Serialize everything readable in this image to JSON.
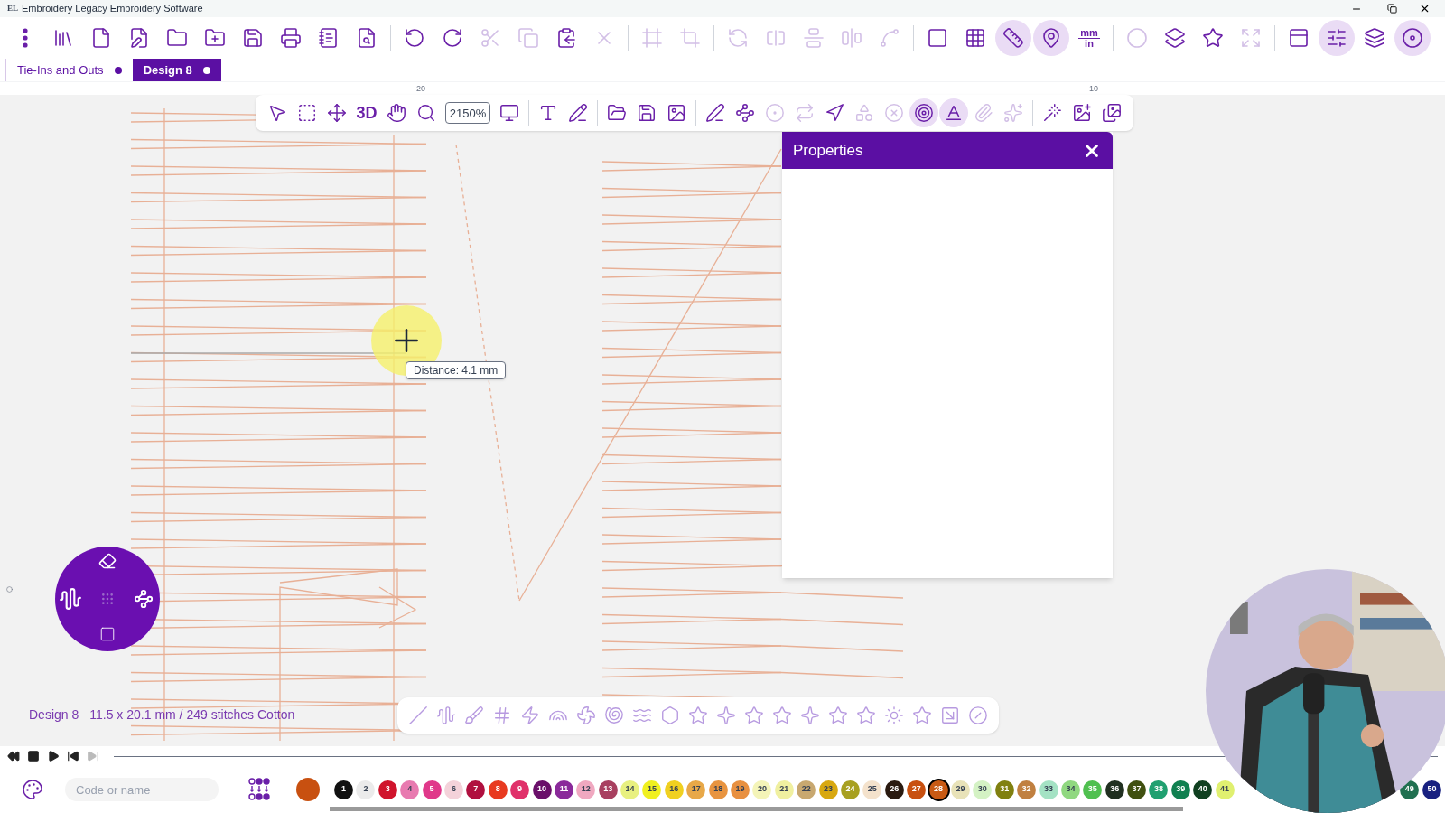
{
  "window": {
    "logo": "EL",
    "title": "Embroidery Legacy Embroidery Software"
  },
  "main_toolbar": [
    {
      "buttons": [
        {
          "kind": "icon",
          "disabled": false,
          "highlighted": false
        },
        {
          "kind": "icon",
          "disabled": false,
          "highlighted": false
        },
        {
          "kind": "icon",
          "disabled": false,
          "highlighted": false
        },
        {
          "kind": "icon",
          "disabled": false,
          "highlighted": false
        },
        {
          "kind": "icon",
          "disabled": false,
          "highlighted": false
        },
        {
          "kind": "icon",
          "disabled": false,
          "highlighted": false
        },
        {
          "kind": "icon",
          "disabled": false,
          "highlighted": false
        },
        {
          "kind": "icon",
          "disabled": false,
          "highlighted": false
        },
        {
          "kind": "icon",
          "disabled": false,
          "highlighted": false
        },
        {
          "kind": "icon",
          "disabled": false,
          "highlighted": false
        }
      ]
    },
    {
      "buttons": [
        {
          "kind": "icon",
          "disabled": false,
          "highlighted": false
        },
        {
          "kind": "icon",
          "disabled": false,
          "highlighted": false
        },
        {
          "kind": "icon",
          "disabled": true,
          "highlighted": false
        },
        {
          "kind": "icon",
          "disabled": true,
          "highlighted": false
        },
        {
          "kind": "icon",
          "disabled": false,
          "highlighted": false
        },
        {
          "kind": "icon",
          "disabled": true,
          "highlighted": false
        }
      ]
    },
    {
      "buttons": [
        {
          "kind": "icon",
          "disabled": true,
          "highlighted": false
        },
        {
          "kind": "icon",
          "disabled": true,
          "highlighted": false
        }
      ]
    },
    {
      "buttons": [
        {
          "kind": "icon",
          "disabled": true,
          "highlighted": false
        },
        {
          "kind": "icon",
          "disabled": true,
          "highlighted": false
        },
        {
          "kind": "icon",
          "disabled": true,
          "highlighted": false
        },
        {
          "kind": "icon",
          "disabled": true,
          "highlighted": false
        },
        {
          "kind": "icon",
          "disabled": true,
          "highlighted": false
        }
      ]
    },
    {
      "buttons": [
        {
          "kind": "icon",
          "disabled": false,
          "highlighted": false
        },
        {
          "kind": "icon",
          "disabled": false,
          "highlighted": false
        },
        {
          "kind": "icon",
          "disabled": false,
          "highlighted": true
        },
        {
          "kind": "icon",
          "disabled": false,
          "highlighted": true
        },
        {
          "kind": "units",
          "top": "mm",
          "bottom": "in",
          "disabled": false,
          "highlighted": false
        }
      ]
    },
    {
      "buttons": [
        {
          "kind": "icon",
          "disabled": true,
          "highlighted": false
        },
        {
          "kind": "icon",
          "disabled": false,
          "highlighted": false
        },
        {
          "kind": "icon",
          "disabled": false,
          "highlighted": false
        },
        {
          "kind": "icon",
          "disabled": true,
          "highlighted": false
        }
      ]
    },
    {
      "buttons": [
        {
          "kind": "icon",
          "disabled": false,
          "highlighted": false
        },
        {
          "kind": "icon",
          "disabled": false,
          "highlighted": true
        },
        {
          "kind": "icon",
          "disabled": false,
          "highlighted": false
        },
        {
          "kind": "icon",
          "disabled": false,
          "highlighted": true
        }
      ]
    }
  ],
  "tabs": [
    {
      "label": "Tie-Ins and Outs",
      "selected": false,
      "modified": true
    },
    {
      "label": "Design 8",
      "selected": true,
      "modified": true
    }
  ],
  "ruler_labels": [
    "-20",
    "-10"
  ],
  "canvas_toolbar": [
    {
      "buttons": [
        {
          "kind": "icon",
          "disabled": false,
          "highlighted": false
        },
        {
          "kind": "icon",
          "disabled": false,
          "highlighted": false
        },
        {
          "kind": "icon",
          "disabled": false,
          "highlighted": false
        },
        {
          "kind": "text",
          "label": "3D",
          "disabled": false,
          "highlighted": false
        },
        {
          "kind": "icon",
          "disabled": false,
          "highlighted": false
        },
        {
          "kind": "icon",
          "disabled": false,
          "highlighted": false
        },
        {
          "kind": "zoom",
          "value": "2150%",
          "disabled": false,
          "highlighted": false
        },
        {
          "kind": "icon",
          "disabled": false,
          "highlighted": false
        }
      ]
    },
    {
      "buttons": [
        {
          "kind": "icon",
          "disabled": false,
          "highlighted": false
        },
        {
          "kind": "icon",
          "disabled": false,
          "highlighted": false
        }
      ]
    },
    {
      "buttons": [
        {
          "kind": "icon",
          "disabled": false,
          "highlighted": false
        },
        {
          "kind": "icon",
          "disabled": false,
          "highlighted": false
        },
        {
          "kind": "icon",
          "disabled": false,
          "highlighted": false
        }
      ]
    },
    {
      "buttons": [
        {
          "kind": "icon",
          "disabled": false,
          "highlighted": false
        },
        {
          "kind": "icon",
          "disabled": false,
          "highlighted": false
        },
        {
          "kind": "icon",
          "disabled": true,
          "highlighted": false
        },
        {
          "kind": "icon",
          "disabled": true,
          "highlighted": false
        },
        {
          "kind": "icon",
          "disabled": false,
          "highlighted": false
        },
        {
          "kind": "icon",
          "disabled": true,
          "highlighted": false
        },
        {
          "kind": "icon",
          "disabled": true,
          "highlighted": false
        },
        {
          "kind": "icon",
          "disabled": false,
          "highlighted": true
        },
        {
          "kind": "icon",
          "disabled": false,
          "highlighted": true
        },
        {
          "kind": "icon",
          "disabled": true,
          "highlighted": false
        },
        {
          "kind": "icon",
          "disabled": true,
          "highlighted": false
        }
      ]
    },
    {
      "buttons": [
        {
          "kind": "icon",
          "disabled": false,
          "highlighted": false
        },
        {
          "kind": "icon",
          "disabled": false,
          "highlighted": false
        },
        {
          "kind": "icon",
          "disabled": false,
          "highlighted": false
        }
      ]
    }
  ],
  "measure_tooltip": "Distance: 4.1 mm",
  "properties_panel": {
    "title": "Properties"
  },
  "status": {
    "design": "Design 8",
    "info": "11.5 x 20.1 mm / 249 stitches Cotton"
  },
  "playback": [
    {
      "disabled": false
    },
    {
      "disabled": false
    },
    {
      "disabled": false
    },
    {
      "disabled": false
    },
    {
      "disabled": true
    }
  ],
  "thread_search": {
    "placeholder": "Code or name"
  },
  "current_thread": {
    "color": "#c85010"
  },
  "swatches": [
    {
      "number": "1",
      "color": "#111111",
      "selected": false
    },
    {
      "number": "2",
      "color": "#ebebeb",
      "selected": false
    },
    {
      "number": "3",
      "color": "#d0142c",
      "selected": false
    },
    {
      "number": "4",
      "color": "#e87ab0",
      "selected": false
    },
    {
      "number": "5",
      "color": "#e0388a",
      "selected": false
    },
    {
      "number": "6",
      "color": "#f4d2da",
      "selected": false
    },
    {
      "number": "7",
      "color": "#b0103f",
      "selected": false
    },
    {
      "number": "8",
      "color": "#e83a20",
      "selected": false
    },
    {
      "number": "9",
      "color": "#e0306a",
      "selected": false
    },
    {
      "number": "10",
      "color": "#6a0f6a",
      "selected": false
    },
    {
      "number": "11",
      "color": "#8a2a9a",
      "selected": false
    },
    {
      "number": "12",
      "color": "#f0a8c0",
      "selected": false
    },
    {
      "number": "13",
      "color": "#a84060",
      "selected": false
    },
    {
      "number": "14",
      "color": "#e8f080",
      "selected": false
    },
    {
      "number": "15",
      "color": "#f0f020",
      "selected": false
    },
    {
      "number": "16",
      "color": "#f0d020",
      "selected": false
    },
    {
      "number": "17",
      "color": "#e8a848",
      "selected": false
    },
    {
      "number": "18",
      "color": "#e89440",
      "selected": false
    },
    {
      "number": "19",
      "color": "#e89040",
      "selected": false
    },
    {
      "number": "20",
      "color": "#f4f4b8",
      "selected": false
    },
    {
      "number": "21",
      "color": "#f0f0a0",
      "selected": false
    },
    {
      "number": "22",
      "color": "#c8a870",
      "selected": false
    },
    {
      "number": "23",
      "color": "#d8a810",
      "selected": false
    },
    {
      "number": "24",
      "color": "#a8a020",
      "selected": false
    },
    {
      "number": "25",
      "color": "#f4e2cc",
      "selected": false
    },
    {
      "number": "26",
      "color": "#2a1a10",
      "selected": false
    },
    {
      "number": "27",
      "color": "#c85010",
      "selected": false
    },
    {
      "number": "28",
      "color": "#c85a14",
      "selected": true
    },
    {
      "number": "29",
      "color": "#e8e2b8",
      "selected": false
    },
    {
      "number": "30",
      "color": "#d4f2c4",
      "selected": false
    },
    {
      "number": "31",
      "color": "#808010",
      "selected": false
    },
    {
      "number": "32",
      "color": "#c08040",
      "selected": false
    },
    {
      "number": "33",
      "color": "#a4e2c4",
      "selected": false
    },
    {
      "number": "34",
      "color": "#90d880",
      "selected": false
    },
    {
      "number": "35",
      "color": "#50c050",
      "selected": false
    },
    {
      "number": "36",
      "color": "#203020",
      "selected": false
    },
    {
      "number": "37",
      "color": "#405010",
      "selected": false
    },
    {
      "number": "38",
      "color": "#20a070",
      "selected": false
    },
    {
      "number": "39",
      "color": "#108050",
      "selected": false
    },
    {
      "number": "40",
      "color": "#104020",
      "selected": false
    },
    {
      "number": "41",
      "color": "#e0f070",
      "selected": false
    }
  ],
  "swatches_right": [
    {
      "number": "49",
      "color": "#207050",
      "selected": false
    },
    {
      "number": "50",
      "color": "#182080",
      "selected": false
    }
  ]
}
